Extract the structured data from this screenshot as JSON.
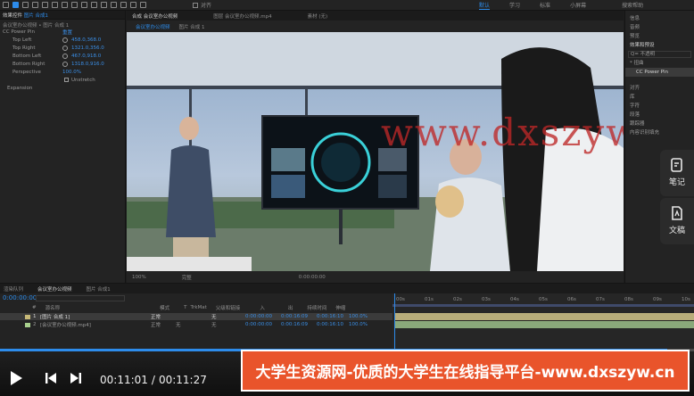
{
  "toolbar": {
    "ws_labels": [
      "默认",
      "学习",
      "标准",
      "小屏幕"
    ],
    "active_ws": "默认",
    "search_label": "搜索帮助",
    "checkbox_label": "对齐"
  },
  "effects_panel": {
    "tabs": [
      "效果控件",
      "图片 合成1"
    ],
    "active_tab": "效果控件",
    "breadcrumb": "会议室办公视频 • 图片 合成 1",
    "effect_name": "CC Power Pin",
    "reset_label": "重置",
    "props": [
      {
        "name": "Top Left",
        "value": "458.0,368.0"
      },
      {
        "name": "Top Right",
        "value": "1321.0,356.0"
      },
      {
        "name": "Bottom Left",
        "value": "467.0,918.0"
      },
      {
        "name": "Bottom Right",
        "value": "1318.0,916.0"
      }
    ],
    "perspective": {
      "name": "Perspective",
      "value": "100.0%"
    },
    "unstretch": "Unstretch",
    "expansion": "Expansion"
  },
  "viewer": {
    "tabs": [
      "合成 会议室办公视频",
      "图层 会议室办公视频.mp4",
      "素材 (无)"
    ],
    "sub_tabs": [
      "会议室办公视频",
      "图片 合成 1"
    ],
    "zoom": "100%",
    "quality": "完整",
    "timecode": "0:00:00:00"
  },
  "watermark": "www.dxszyw.cn",
  "right_panel": {
    "items": [
      "信息",
      "音频",
      "预览",
      "效果和预设",
      "对齐",
      "库",
      "字符",
      "段落",
      "跟踪器",
      "内容识别填充"
    ],
    "search_placeholder": "Q= 不透明",
    "preset_folder": "* 扭曲",
    "preset_item": "CC Power Pin"
  },
  "side_buttons": [
    {
      "label": "笔记"
    },
    {
      "label": "文稿"
    }
  ],
  "timeline": {
    "tabs": [
      "渲染队列",
      "会议室办公视频",
      "图片 合成1"
    ],
    "timecode": "0:00:00:00",
    "columns": [
      "#",
      "源名称",
      "模式",
      "T",
      "TrkMat",
      "父级和链接",
      "入",
      "出",
      "持续时间",
      "伸缩"
    ],
    "layers": [
      {
        "num": "1",
        "name": "[图片 合成 1]",
        "color": "#c7b977",
        "mode": "正常",
        "parent": "无",
        "in": "0:00:00:00",
        "out": "0:00:16:09",
        "duration": "0:00:16:10",
        "stretch": "100.0%"
      },
      {
        "num": "2",
        "name": "[会议室办公视频.mp4]",
        "color": "#a8d08d",
        "mode": "正常",
        "trkmat": "无",
        "parent": "无",
        "in": "0:00:00:00",
        "out": "0:00:16:09",
        "duration": "0:00:16:10",
        "stretch": "100.0%"
      }
    ],
    "ruler": [
      "00s",
      "01s",
      "02s",
      "03s",
      "04s",
      "05s",
      "06s",
      "07s",
      "08s",
      "09s",
      "10s"
    ]
  },
  "player": {
    "current_time": "00:11:01",
    "total_time": "00:11:27",
    "progress": 0.962
  },
  "banner": "大学生资源网-优质的大学生在线指导平台-www.dxszyw.cn",
  "colors": {
    "accent": "#2d8ceb",
    "banner_bg": "#e9542b"
  }
}
